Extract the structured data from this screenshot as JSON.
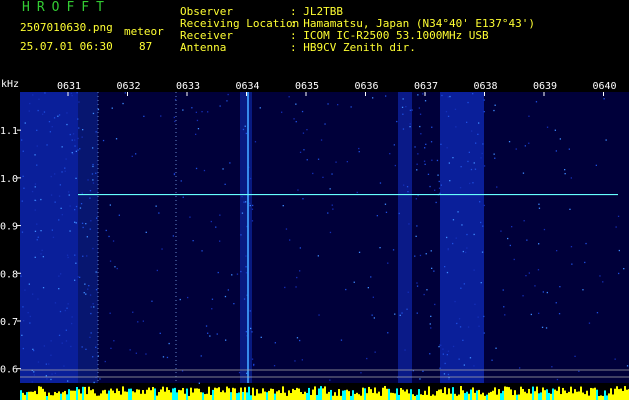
{
  "header": {
    "logo": "HROFFT",
    "filename": "2507010630.png",
    "timestamp": "25.07.01 06:30",
    "mode_label": "meteor",
    "count": "87",
    "info": [
      {
        "label": "Observer",
        "value": ": JL2TBB"
      },
      {
        "label": "Receiving Location",
        "value": ": Hamamatsu, Japan (N34°40' E137°43')"
      },
      {
        "label": "Receiver",
        "value": ": ICOM IC-R2500 53.1000MHz USB"
      },
      {
        "label": "Antenna",
        "value": ": HB9CV Zenith dir."
      }
    ]
  },
  "chart_data": {
    "type": "heatmap",
    "ylabel": "kHz",
    "x_ticks": [
      "0631",
      "0632",
      "0633",
      "0634",
      "0635",
      "0636",
      "0637",
      "0638",
      "0639",
      "0640"
    ],
    "y_ticks": [
      "1.1",
      "1.0",
      "0.9",
      "0.8",
      "0.7",
      "0.6"
    ],
    "ylim": [
      0.57,
      1.18
    ],
    "carrier_khz": 0.965,
    "colors": {
      "background": "#00003a",
      "carrier": "#66ffff",
      "tick": "#ffffff",
      "gridline": "#aaaaaa",
      "bottom_bar_a": "#ffff00",
      "bottom_bar_b": "#00ffff"
    }
  }
}
